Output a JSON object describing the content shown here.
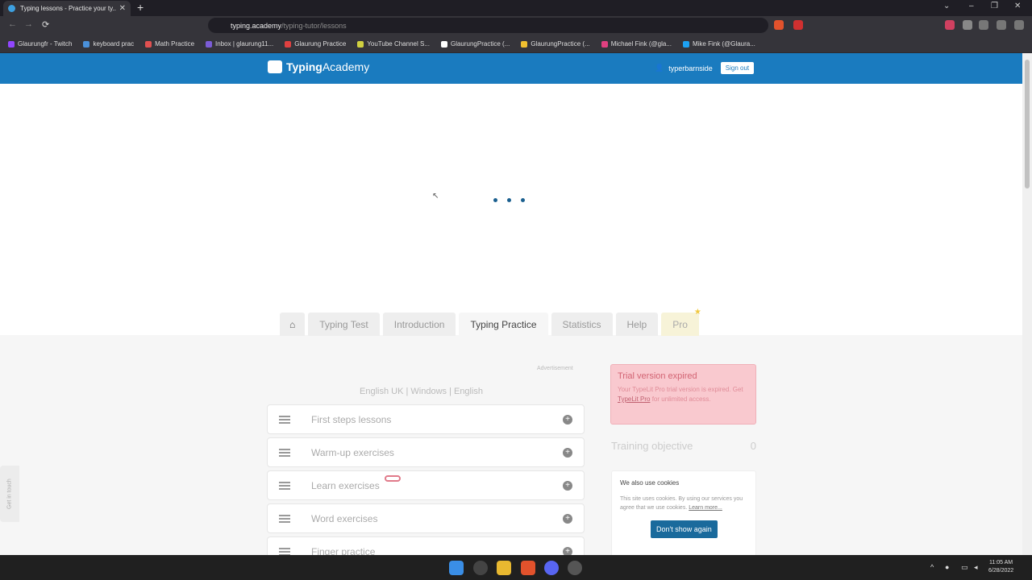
{
  "browser": {
    "tab_title": "Typing lessons - Practice your ty...",
    "tab_close": "✕",
    "new_tab": "+",
    "url_host": "typing.academy",
    "url_path": "/typing-tutor/lessons",
    "back": "←",
    "forward": "→",
    "reload": "⟳",
    "win_min": "–",
    "win_max": "❐",
    "win_close": "✕",
    "win_chevron": "⌄",
    "bookmarks": [
      {
        "label": "Glaurungfr - Twitch",
        "color": "#9146ff"
      },
      {
        "label": "keyboard prac",
        "color": "#4a90d9"
      },
      {
        "label": "Math Practice",
        "color": "#e05050"
      },
      {
        "label": "Inbox | glaurung11...",
        "color": "#7b5cd6"
      },
      {
        "label": "Glaurung Practice",
        "color": "#e04040"
      },
      {
        "label": "YouTube Channel S...",
        "color": "#d0d040"
      },
      {
        "label": "GlaurungPractice (...",
        "color": "#ffffff"
      },
      {
        "label": "GlaurungPractice (...",
        "color": "#f0c030"
      },
      {
        "label": "Michael Fink (@gla...",
        "color": "#e04080"
      },
      {
        "label": "Mike Fink (@Glaura...",
        "color": "#1da1f2"
      }
    ]
  },
  "site": {
    "logo_bold": "Typing",
    "logo_light": "Academy",
    "user_icon": "👤",
    "username": "typerbarnside",
    "signout": "Sign out"
  },
  "tabs": {
    "home": "⌂",
    "typing_test": "Typing Test",
    "introduction": "Introduction",
    "typing_practice": "Typing Practice",
    "statistics": "Statistics",
    "help": "Help",
    "pro": "Pro",
    "pro_star": "★"
  },
  "lessons_panel": {
    "advertisement": "Advertisement",
    "layout_line": "English UK | Windows | English",
    "items": [
      {
        "label": "First steps lessons"
      },
      {
        "label": "Warm-up exercises"
      },
      {
        "label": "Learn exercises"
      },
      {
        "label": "Word exercises"
      },
      {
        "label": "Finger practice"
      }
    ],
    "plus": "+"
  },
  "trial": {
    "title": "Trial version expired",
    "text_before": "Your TypeLit Pro trial version is expired. Get ",
    "link": "TypeLit Pro",
    "text_after": " for unlimited access."
  },
  "objective": {
    "label": "Training objective",
    "value": "0"
  },
  "cookies": {
    "title": "We also use cookies",
    "text": "This site uses cookies. By using our services you agree that we use cookies. ",
    "link": "Learn more...",
    "button": "Don't show again"
  },
  "side_tab": "Get in touch",
  "taskbar": {
    "tray_chevron": "^",
    "time": "11:05 AM",
    "date": "6/28/2022"
  }
}
